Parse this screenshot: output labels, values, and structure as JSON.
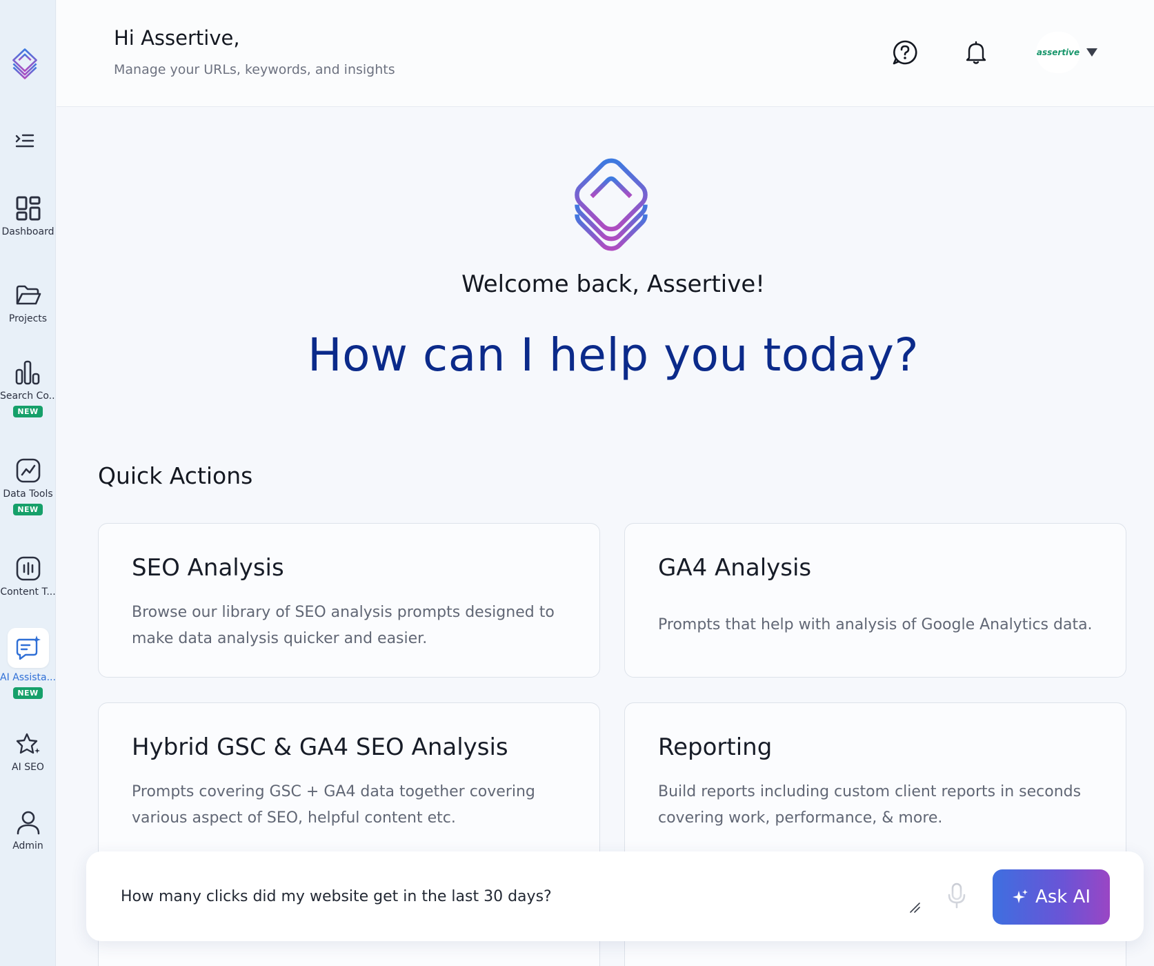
{
  "header": {
    "greeting": "Hi Assertive,",
    "subtitle": "Manage your URLs, keywords, and insights",
    "profile_name": "assertive"
  },
  "sidebar": {
    "items": [
      {
        "label": "Dashboard",
        "icon": "dashboard-grid-icon",
        "badge": ""
      },
      {
        "label": "Projects",
        "icon": "folder-icon",
        "badge": ""
      },
      {
        "label": "Search Co...",
        "icon": "bar-chart-icon",
        "badge": "NEW"
      },
      {
        "label": "Data Tools",
        "icon": "line-chart-icon",
        "badge": "NEW"
      },
      {
        "label": "Content T...",
        "icon": "waveform-icon",
        "badge": ""
      },
      {
        "label": "AI Assista...",
        "icon": "chat-sparkle-icon",
        "badge": "NEW"
      },
      {
        "label": "AI SEO",
        "icon": "star-sparkle-icon",
        "badge": ""
      },
      {
        "label": "Admin",
        "icon": "user-icon",
        "badge": ""
      }
    ]
  },
  "main": {
    "welcome": "Welcome back, Assertive!",
    "headline": "How can I help you today?",
    "quick_actions_title": "Quick Actions",
    "cards": [
      {
        "title": "SEO Analysis",
        "desc": "Browse our library of SEO analysis prompts designed to make data analysis quicker and easier."
      },
      {
        "title": "GA4 Analysis",
        "desc": "Prompts that help with analysis of Google Analytics data."
      },
      {
        "title": "Hybrid GSC & GA4 SEO Analysis",
        "desc": "Prompts covering GSC + GA4 data together covering various aspect of SEO, helpful content etc."
      },
      {
        "title": "Reporting",
        "desc": "Build reports including custom client reports in seconds covering work, performance, & more."
      }
    ]
  },
  "ask": {
    "value": "How many clicks did my website get in the last 30 days?",
    "button_label": "Ask AI"
  },
  "colors": {
    "accent_blue": "#0b2a8a",
    "badge_green": "#16a06a",
    "active_blue": "#2f6fd6",
    "button_gradient_start": "#3e6fe0",
    "button_gradient_end": "#9a46c4"
  }
}
